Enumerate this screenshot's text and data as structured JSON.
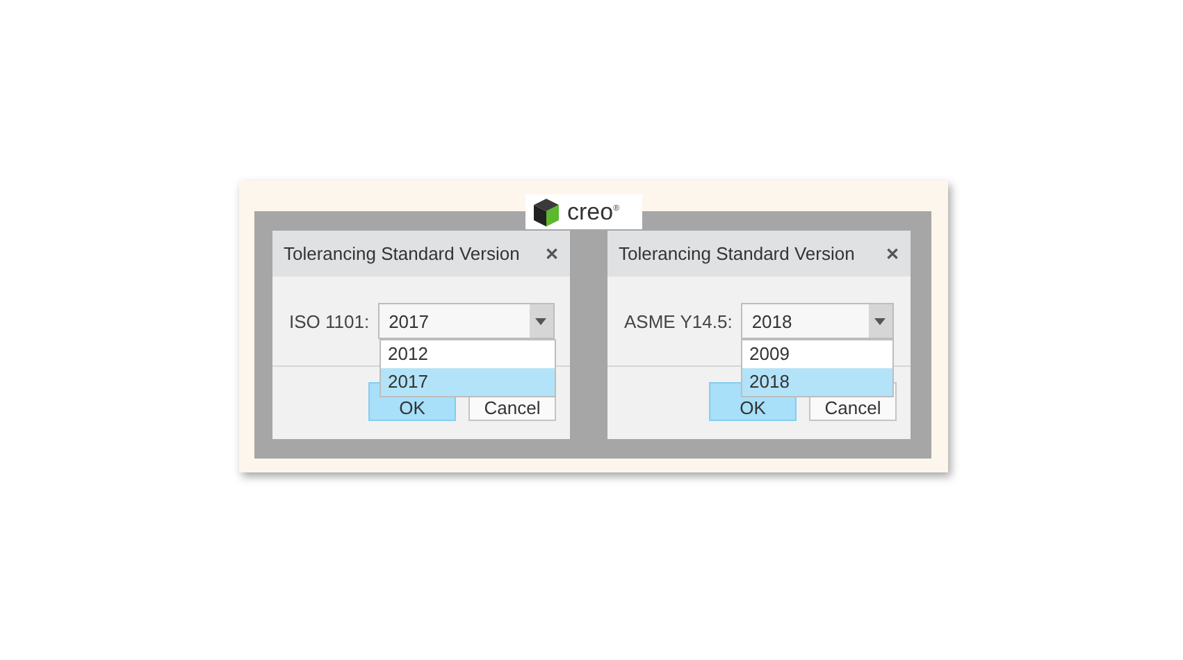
{
  "logo": {
    "text": "creo$^{®}$"
  },
  "dialogs": [
    {
      "title": "Tolerancing Standard Version",
      "close": "✕",
      "label": "ISO 1101:",
      "value": "2017",
      "expanded": true,
      "options": [
        {
          "label": "2012",
          "selected": false
        },
        {
          "label": "2017",
          "selected": true
        }
      ],
      "buttons": [
        {
          "label": "OK",
          "kind": "primary"
        },
        {
          "label": "Cancel",
          "kind": "secondary"
        }
      ]
    },
    {
      "title": "Tolerancing Standard Version",
      "close": "✕",
      "label": "ASME Y14.5:",
      "value": "2018",
      "expanded": true,
      "options": [
        {
          "label": "2009",
          "selected": false
        },
        {
          "label": "2018",
          "selected": true
        }
      ],
      "buttons": [
        {
          "label": "OK",
          "kind": "primary"
        },
        {
          "label": "Cancel",
          "kind": "secondary"
        }
      ]
    }
  ]
}
